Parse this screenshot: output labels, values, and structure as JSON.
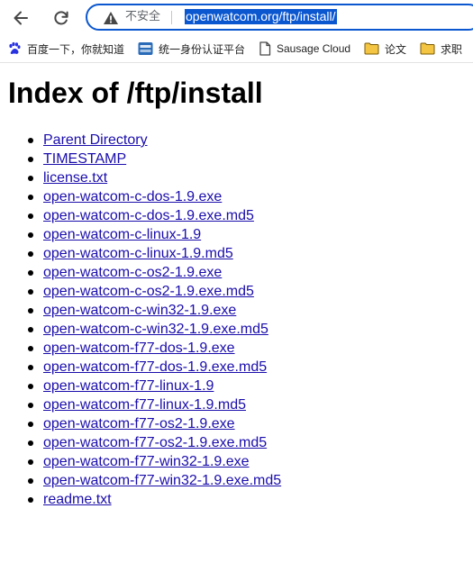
{
  "browser": {
    "security_label": "不安全",
    "url": "openwatcom.org/ftp/install/",
    "bookmarks": [
      {
        "label": "百度一下，你就知道",
        "icon": "baidu-paw-icon"
      },
      {
        "label": "统一身份认证平台",
        "icon": "portal-logo-icon"
      },
      {
        "label": "Sausage Cloud",
        "icon": "page-icon"
      },
      {
        "label": "论文",
        "icon": "folder-icon"
      },
      {
        "label": "求职",
        "icon": "folder-icon"
      }
    ]
  },
  "page": {
    "title": "Index of /ftp/install",
    "files": [
      "Parent Directory",
      "TIMESTAMP",
      "license.txt",
      "open-watcom-c-dos-1.9.exe",
      "open-watcom-c-dos-1.9.exe.md5",
      "open-watcom-c-linux-1.9",
      "open-watcom-c-linux-1.9.md5",
      "open-watcom-c-os2-1.9.exe",
      "open-watcom-c-os2-1.9.exe.md5",
      "open-watcom-c-win32-1.9.exe",
      "open-watcom-c-win32-1.9.exe.md5",
      "open-watcom-f77-dos-1.9.exe",
      "open-watcom-f77-dos-1.9.exe.md5",
      "open-watcom-f77-linux-1.9",
      "open-watcom-f77-linux-1.9.md5",
      "open-watcom-f77-os2-1.9.exe",
      "open-watcom-f77-os2-1.9.exe.md5",
      "open-watcom-f77-win32-1.9.exe",
      "open-watcom-f77-win32-1.9.exe.md5",
      "readme.txt"
    ]
  },
  "colors": {
    "link": "#1a0dab",
    "url_highlight": "#0b57d0",
    "folder": "#f4c542"
  }
}
